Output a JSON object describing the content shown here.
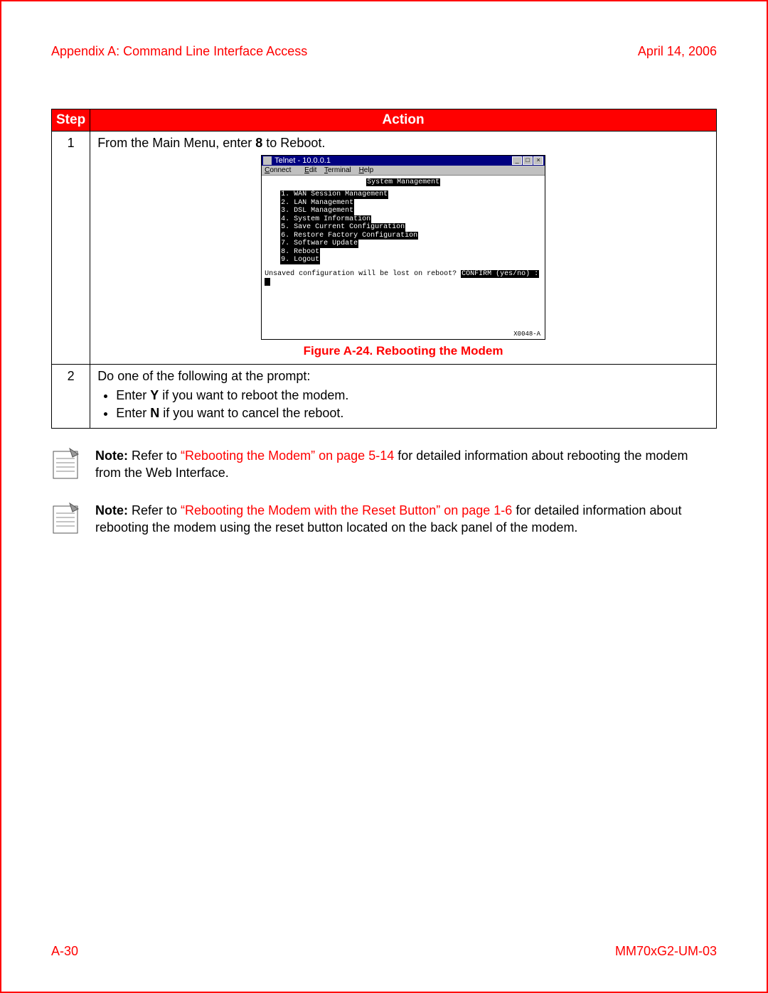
{
  "header": {
    "left": "Appendix A: Command Line Interface Access",
    "right": "April 14, 2006"
  },
  "table": {
    "head_step": "Step",
    "head_action": "Action",
    "rows": [
      {
        "num": "1",
        "intro_pre": "From the Main Menu, enter ",
        "intro_bold": "8",
        "intro_post": " to Reboot.",
        "telnet": {
          "title": "Telnet - 10.0.0.1",
          "menu_connect": "Connect",
          "menu_edit": "Edit",
          "menu_terminal": "Terminal",
          "menu_help": "Help",
          "heading": "System Management",
          "items": [
            "1. WAN Session Management",
            "2. LAN Management",
            "3. DSL Management",
            "4. System Information",
            "5. Save Current Configuration",
            "6. Restore Factory Configuration",
            "7. Software Update",
            "8. Reboot",
            "9. Logout"
          ],
          "prompt_plain": "Unsaved configuration will be lost on reboot? ",
          "prompt_inv": "CONFIRM (yes/no) :",
          "footer_code": "X0048-A"
        },
        "fig_caption": "Figure A-24. Rebooting the Modem"
      },
      {
        "num": "2",
        "intro": "Do one of the following at the prompt:",
        "bullets": [
          {
            "pre": "Enter ",
            "bold": "Y",
            "post": " if you want to reboot the modem."
          },
          {
            "pre": "Enter ",
            "bold": "N",
            "post": " if you want to cancel the reboot."
          }
        ]
      }
    ]
  },
  "notes": [
    {
      "label": "Note: ",
      "pre": "Refer to ",
      "xref": "“Rebooting the Modem” on page 5-14",
      "post": " for detailed information about rebooting the modem from the Web Interface."
    },
    {
      "label": "Note: ",
      "pre": "Refer to ",
      "xref": "“Rebooting the Modem with the Reset Button” on page 1-6",
      "post": " for detailed information about rebooting the modem using the reset button located on the back panel of the modem."
    }
  ],
  "footer": {
    "left": "A-30",
    "right": "MM70xG2-UM-03"
  }
}
